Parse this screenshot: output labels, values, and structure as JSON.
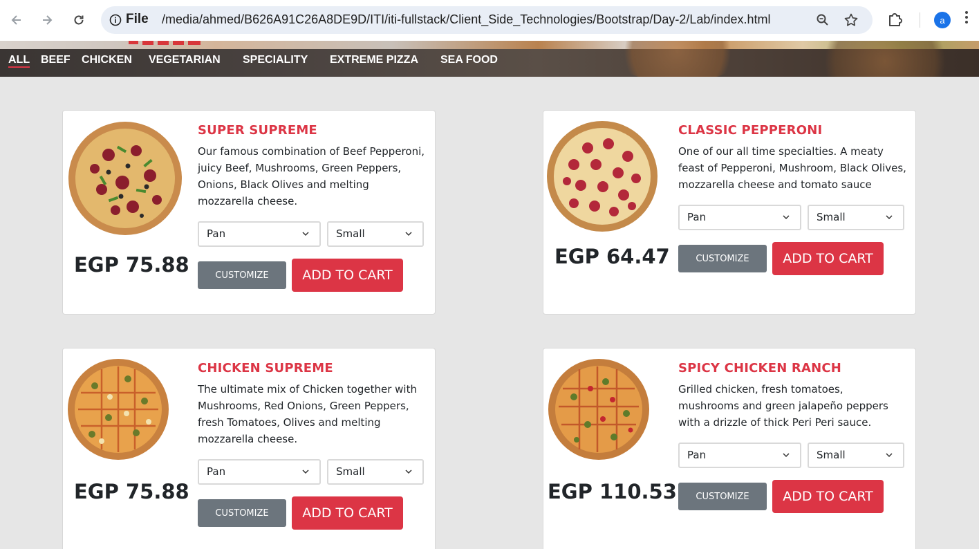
{
  "browser": {
    "scheme_label": "File",
    "url": "/media/ahmed/B626A91C26A8DE9D/ITI/iti-fullstack/Client_Side_Technologies/Bootstrap/Day-2/Lab/index.html",
    "profile_initial": "a"
  },
  "nav": {
    "items": [
      {
        "label": "ALL",
        "active": true
      },
      {
        "label": "BEEF"
      },
      {
        "label": "CHICKEN"
      },
      {
        "label": "VEGETARIAN"
      },
      {
        "label": "SPECIALITY"
      },
      {
        "label": "EXTREME PIZZA"
      },
      {
        "label": "SEA FOOD"
      }
    ]
  },
  "cards": [
    {
      "title": "SUPER SUPREME",
      "description": "Our famous combination of Beef Pepperoni, juicy Beef, Mushrooms, Green Peppers, Onions, Black Olives and melting mozzarella cheese.",
      "price": "EGP 75.88",
      "crust": "Pan",
      "size": "Small",
      "customize_label": "CUSTOMIZE",
      "cart_label": "ADD TO CART",
      "pizza_style": "supreme"
    },
    {
      "title": "CLASSIC PEPPERONI",
      "description": "One of our all time specialties. A meaty feast of Pepperoni, Mushroom, Black Olives, mozzarella cheese and tomato sauce",
      "price": "EGP 64.47",
      "crust": "Pan",
      "size": "Small",
      "customize_label": "CUSTOMIZE",
      "cart_label": "ADD TO CART",
      "pizza_style": "pepperoni"
    },
    {
      "title": "CHICKEN SUPREME",
      "description": "The ultimate mix of Chicken together with Mushrooms, Red Onions, Green Peppers, fresh Tomatoes, Olives and melting mozzarella cheese.",
      "price": "EGP 75.88",
      "crust": "Pan",
      "size": "Small",
      "customize_label": "CUSTOMIZE",
      "cart_label": "ADD TO CART",
      "pizza_style": "chicken"
    },
    {
      "title": "SPICY CHICKEN RANCH",
      "description": "Grilled chicken, fresh tomatoes, mushrooms and green jalapeño peppers with a drizzle of thick Peri Peri sauce.",
      "price": "EGP 110.53",
      "crust": "Pan",
      "size": "Small",
      "customize_label": "CUSTOMIZE",
      "cart_label": "ADD TO CART",
      "pizza_style": "chicken"
    }
  ]
}
